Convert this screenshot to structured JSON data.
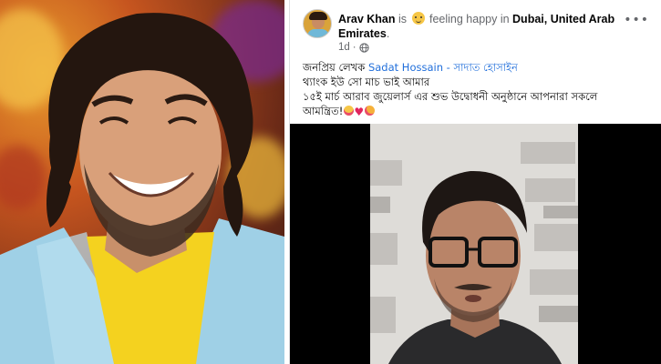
{
  "post": {
    "author": "Arav Khan",
    "is_text": " is ",
    "feeling_text": " feeling happy in ",
    "location": "Dubai, United Arab Emirates",
    "location_end": ".",
    "time": "1d",
    "dot": "·",
    "more": "•••",
    "text": {
      "line1_prefix": "জনপ্রিয় লেখক ",
      "mention": "Sadat Hossain - সাদাত হোসাইন",
      "line2": "থ্যাংক ইউ সো মাচ ভাই আমার",
      "line3": "১৫ই মার্চ আরাব জুয়েলার্স এর শুভ উদ্বোধনী অনুষ্ঠানে আপনারা সকলে",
      "line4": "আমন্ত্রিত!"
    },
    "reactions": [
      "heart-eyes-emoji",
      "red-heart-emoji",
      "smiling-hearts-emoji"
    ]
  },
  "icons": {
    "feeling": "happy-face-emoji",
    "privacy": "globe-icon",
    "menu": "more-options-icon"
  },
  "colors": {
    "link": "#216fdb",
    "meta": "#65676b",
    "text": "#050505",
    "heart": "#e0245e"
  }
}
